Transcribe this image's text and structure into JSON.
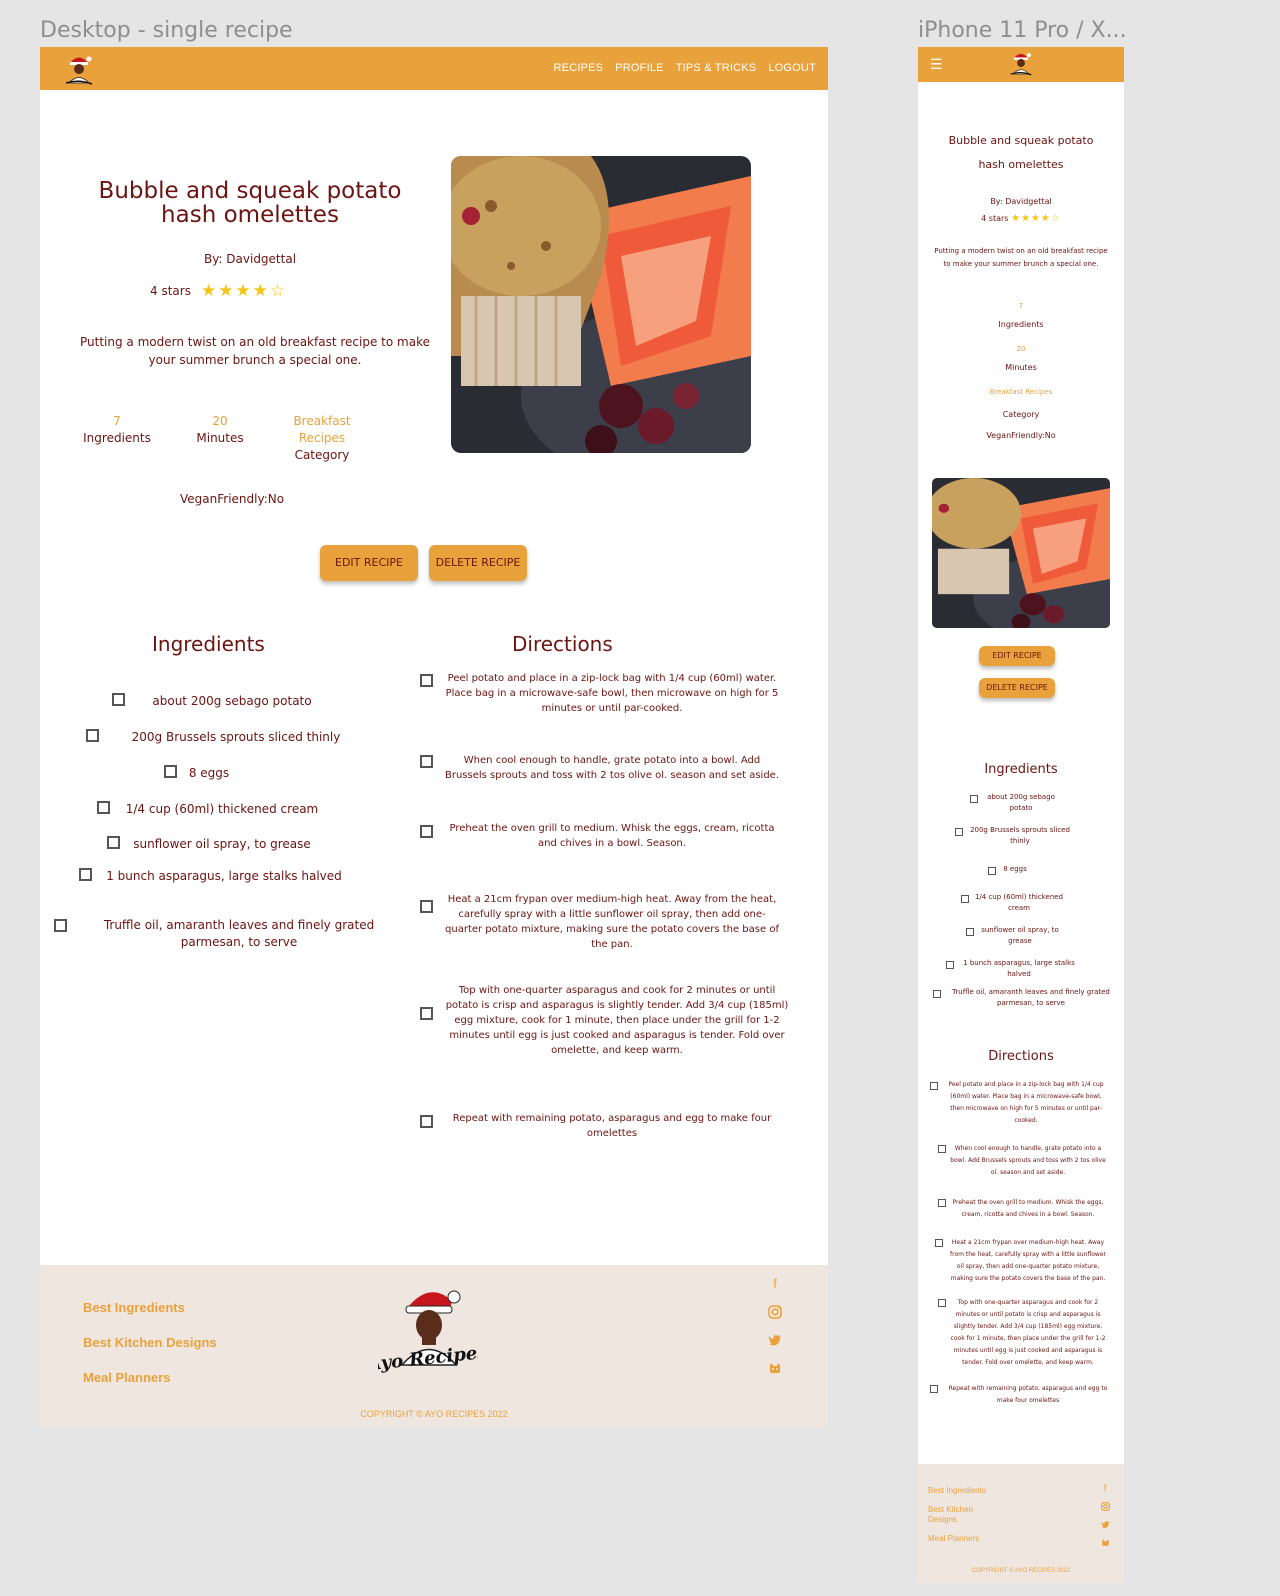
{
  "frames": {
    "desktop_label": "Desktop - single recipe",
    "mobile_label": "iPhone 11 Pro / X..."
  },
  "colors": {
    "accent": "#e9a23b",
    "text": "#6b1410",
    "footer_bg": "#f0e6e0",
    "star": "#f5c518"
  },
  "nav": {
    "links": [
      "RECIPES",
      "PROFILE",
      "TIPS & TRICKS",
      "LOGOUT"
    ],
    "menu_icon": "hamburger-icon"
  },
  "recipe": {
    "title": "Bubble and squeak potato hash omelettes",
    "author": "By: Davidgettal",
    "rating_text": "4 stars",
    "rating_value": 4,
    "rating_max": 5,
    "description": "Putting a modern twist on an old breakfast recipe to make your summer brunch a special one.",
    "ingredients_count": "7",
    "ingredients_label": "Ingredients",
    "minutes_count": "20",
    "minutes_label": "Minutes",
    "category_value": "Breakfast Recipes",
    "category_label": "Category",
    "vegan": "VeganFriendly:No"
  },
  "buttons": {
    "edit": "EDIT RECIPE",
    "delete": "DELETE RECIPE"
  },
  "ingredients": {
    "heading": "Ingredients",
    "items": [
      "about 200g sebago potato",
      "200g Brussels sprouts sliced thinly",
      "8 eggs",
      "1/4 cup (60ml) thickened cream",
      "sunflower oil spray, to grease",
      "1 bunch asparagus, large stalks halved",
      "Truffle oil, amaranth leaves and finely grated parmesan, to serve"
    ]
  },
  "directions": {
    "heading": "Directions",
    "items": [
      "Peel potato and place in a zip-lock bag with 1/4 cup (60ml) water. Place bag in a microwave-safe bowl, then microwave on high for 5 minutes or until par-cooked.",
      "When cool enough to handle, grate potato into a bowl. Add Brussels sprouts and toss with 2 tos olive ol. season and set aside.",
      "Preheat the oven grill to medium. Whisk the eggs, cream, ricotta and chives in a bowl. Season.",
      "Heat a 21cm frypan over medium-high heat. Away from the heat, carefully spray with a little sunflower oil spray, then add one-quarter potato mixture, making sure the potato covers the base of the pan.",
      "Top with one-quarter asparagus and cook for 2 minutes or until potato is crisp and asparagus is slightly tender. Add 3/4 cup (185ml) egg mixture, cook for 1 minute, then place under the grill for 1-2 minutes until egg is just cooked and asparagus is tender. Fold over omelette, and keep warm.",
      "Repeat with remaining potato, asparagus and egg to make four omelettes"
    ]
  },
  "footer": {
    "links": [
      "Best Ingredients",
      "Best Kitchen Designs",
      "Meal Planners"
    ],
    "social_icons": [
      "facebook-icon",
      "instagram-icon",
      "twitter-icon",
      "github-icon"
    ],
    "brand": "Ayo Recipes",
    "copyright": "COPYRIGHT © AYO RECIPES 2022"
  }
}
